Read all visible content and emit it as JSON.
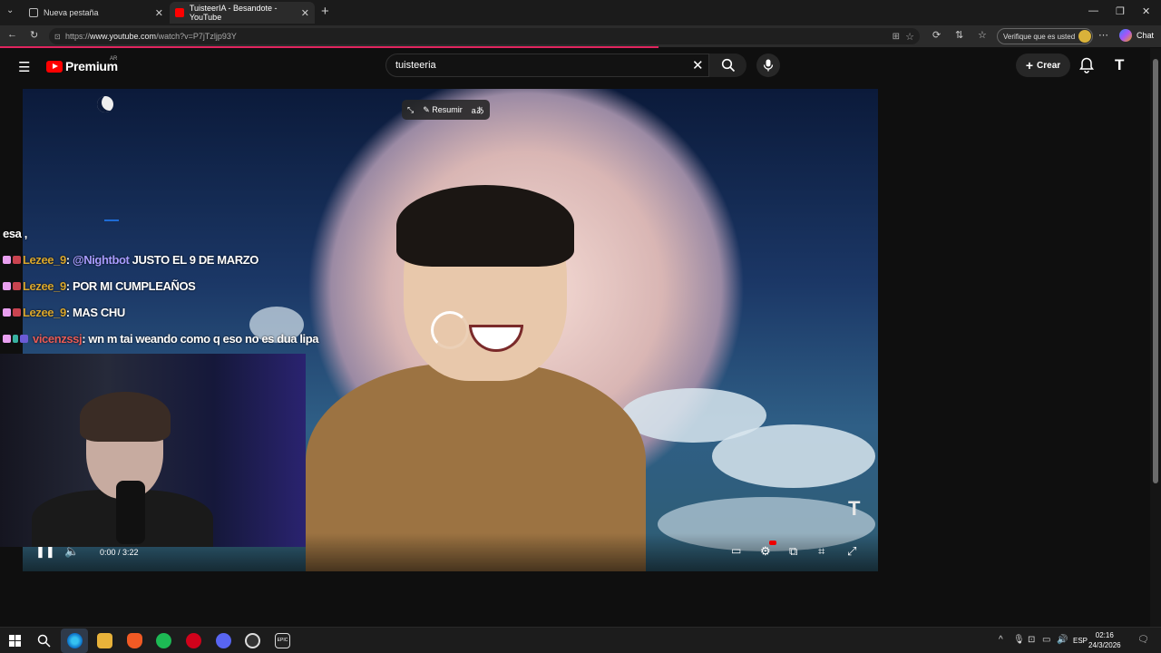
{
  "browser": {
    "tabs": [
      {
        "title": "Nueva pestaña",
        "active": false
      },
      {
        "title": "TuisteerIA - Besandote - YouTube",
        "active": true
      }
    ],
    "url_prefix": "https://",
    "url_domain": "www.youtube.com",
    "url_path": "/watch?v=P7jTzljp93Y",
    "verify_label": "Verifique que es usted",
    "chat_label": "Chat"
  },
  "youtube": {
    "brand": "Premium",
    "country": "AR",
    "search_value": "tuisteeria",
    "create_label": "Crear",
    "account_letter": "T"
  },
  "video": {
    "summarize_label": "Resumir",
    "time": "0:00 / 3:22",
    "watermark": "T"
  },
  "chat": [
    {
      "user": "",
      "text": "esa ,"
    },
    {
      "user": "Lezee_9",
      "mention": "@Nightbot",
      "text": "JUSTO EL 9 DE MARZO"
    },
    {
      "user": "Lezee_9",
      "text": "POR MI CUMPLEAÑOS"
    },
    {
      "user": "Lezee_9",
      "text": "MAS CHU"
    },
    {
      "user": "vicenzssj",
      "text": "wn m tai weando como q eso no es dua lipa"
    }
  ],
  "taskbar": {
    "lang": "ESP",
    "time": "02:16",
    "date": "24/3/2026"
  },
  "colors": {
    "accent": "#ff0000",
    "load_line": "#e0245e",
    "user_gold": "#d9a62c",
    "user_red": "#e85b57",
    "mention": "#a89cff"
  }
}
